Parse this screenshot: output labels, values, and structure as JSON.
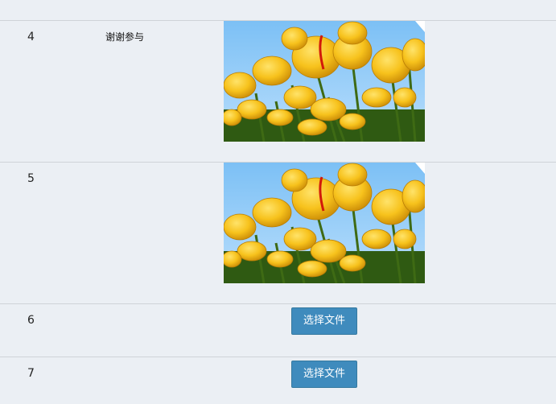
{
  "rows": [
    {
      "index": "4",
      "name": "谢谢参与",
      "image": "tulips-photo"
    },
    {
      "index": "5",
      "name": "",
      "image": "tulips-photo"
    },
    {
      "index": "6",
      "name": "",
      "upload_label": "选择文件"
    },
    {
      "index": "7",
      "name": "",
      "upload_label": "选择文件"
    }
  ],
  "colors": {
    "background": "#ebeff4",
    "divider": "#cfd3d8",
    "button": "#3f8bbd",
    "button_text": "#ffffff"
  }
}
